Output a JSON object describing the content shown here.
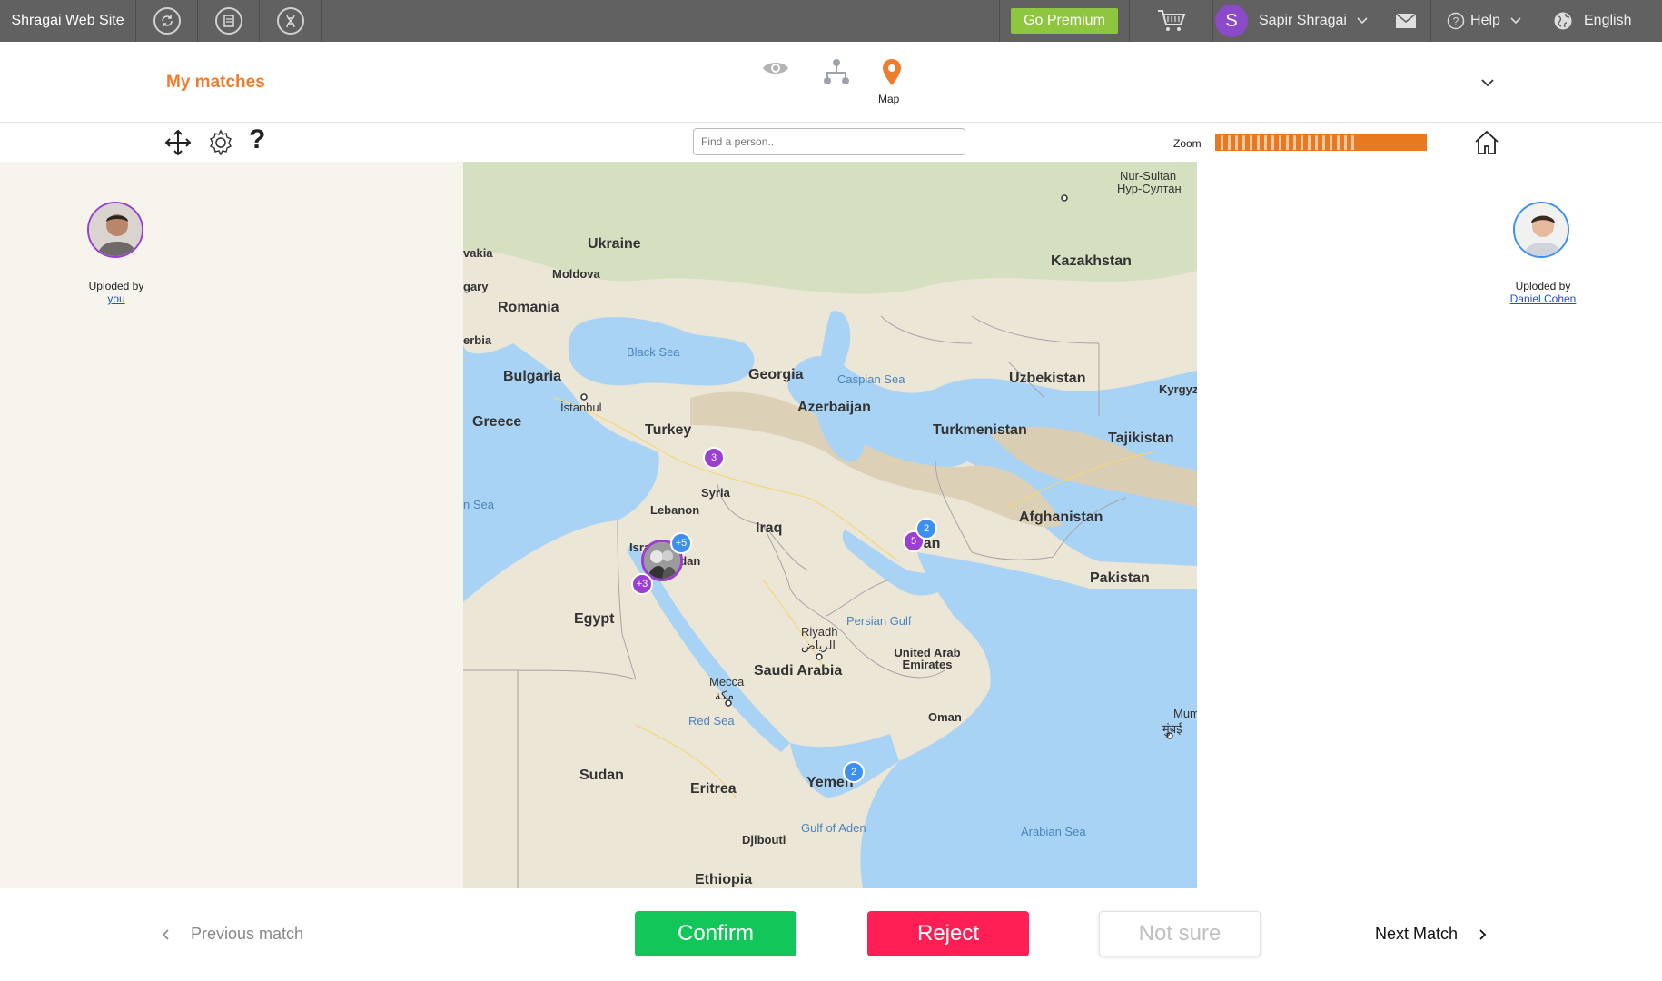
{
  "topbar": {
    "site_name": "Shragai Web Site",
    "premium_label": "Go Premium",
    "user_initial": "S",
    "user_name": "Sapir Shragai",
    "help_label": "Help",
    "language_label": "English"
  },
  "header": {
    "title": "My matches",
    "views": [
      {
        "name": "eye",
        "label": ""
      },
      {
        "name": "tree",
        "label": ""
      },
      {
        "name": "map",
        "label": "Map"
      }
    ]
  },
  "toolbar": {
    "search_placeholder": "Find a person..",
    "zoom_label": "Zoom",
    "zoom_level": 0.68
  },
  "left_person": {
    "uploaded_by_label": "Uploded by",
    "uploader": "you"
  },
  "right_person": {
    "uploaded_by_label": "Uploded by",
    "uploader": "Daniel Cohen"
  },
  "map": {
    "labels": {
      "ukraine": "Ukraine",
      "moldova": "Moldova",
      "romania": "Romania",
      "bulgaria": "Bulgaria",
      "greece": "Greece",
      "turkey": "Turkey",
      "georgia": "Georgia",
      "azerbaijan": "Azerbaijan",
      "syria": "Syria",
      "lebanon": "Lebanon",
      "iraq": "Iraq",
      "egypt": "Egypt",
      "saudi": "Saudi Arabia",
      "sudan": "Sudan",
      "eritrea": "Eritrea",
      "yemen": "Yemen",
      "ethiopia": "Ethiopia",
      "djibouti": "Djibouti",
      "oman": "Oman",
      "uae": "United Arab Emirates",
      "kazakhstan": "Kazakhstan",
      "uzbekistan": "Uzbekistan",
      "turkmenistan": "Turkmenistan",
      "tajikistan": "Tajikistan",
      "kyrgyz": "Kyrgyz",
      "afghanistan": "Afghanistan",
      "pakistan": "Pakistan",
      "iran": "Iran",
      "israel": "Isra",
      "jordan": "Jordan",
      "riyadh": "Riyadh",
      "riyadh_ar": "الرياض",
      "mecca": "Mecca",
      "mecca_ar": "مكة",
      "istanbul": "İstanbul",
      "nursultan": "Nur-Sultan",
      "nursultan_cyr": "Нур-Султан",
      "mumbai": "Mumbai",
      "mumbai_hi": "मुंबई",
      "serbia": "erbia",
      "slovakia": "vakia",
      "hungary": "gary",
      "black_sea": "Black Sea",
      "caspian_sea": "Caspian Sea",
      "persian_gulf": "Persian Gulf",
      "red_sea": "Red Sea",
      "gulf_of_aden": "Gulf of Aden",
      "arabian_sea": "Arabian Sea",
      "med_sea": "n Sea"
    },
    "clusters": [
      {
        "id": "turkey",
        "count": "3",
        "color": "#9a3fd1"
      },
      {
        "id": "israel-plus5",
        "count": "+5",
        "color": "#3d8ff0"
      },
      {
        "id": "israel-plus3",
        "count": "+3",
        "color": "#9a3fd1"
      },
      {
        "id": "iran-5",
        "count": "5",
        "color": "#9a3fd1"
      },
      {
        "id": "iran-2",
        "count": "2",
        "color": "#3d8ff0"
      },
      {
        "id": "yemen-2",
        "count": "2",
        "color": "#3d8ff0"
      }
    ]
  },
  "actions": {
    "previous": "Previous match",
    "confirm": "Confirm",
    "reject": "Reject",
    "not_sure": "Not sure",
    "next": "Next Match"
  },
  "colors": {
    "accent": "#ef7d2d",
    "confirm": "#12c65a",
    "reject": "#ff1f55",
    "premium": "#8fc63f"
  }
}
